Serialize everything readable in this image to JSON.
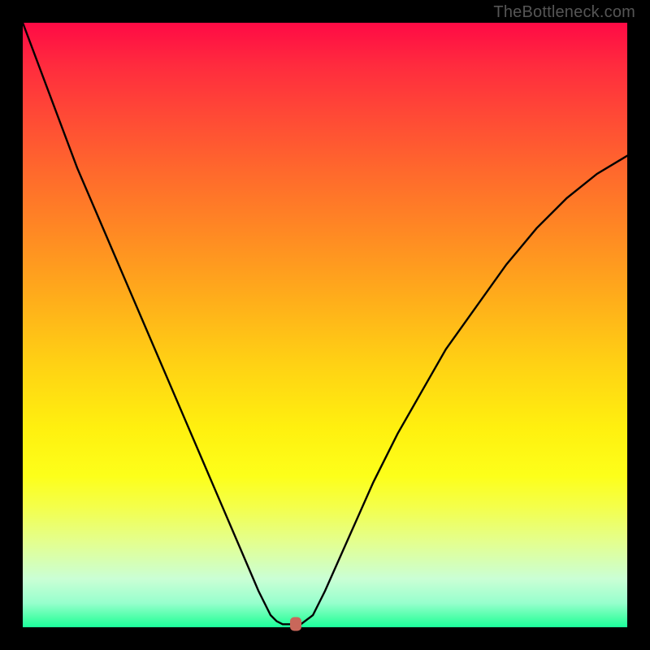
{
  "watermark": "TheBottleneck.com",
  "chart_data": {
    "type": "line",
    "title": "",
    "xlabel": "",
    "ylabel": "",
    "xlim": [
      0,
      100
    ],
    "ylim": [
      0,
      100
    ],
    "background_gradient": {
      "direction": "vertical",
      "stops": [
        {
          "pos": 0,
          "color": "#ff0a45"
        },
        {
          "pos": 25,
          "color": "#ff6a2c"
        },
        {
          "pos": 50,
          "color": "#ffc516"
        },
        {
          "pos": 75,
          "color": "#fdff1a"
        },
        {
          "pos": 100,
          "color": "#1bff9c"
        }
      ]
    },
    "series": [
      {
        "name": "curve",
        "color": "#000000",
        "x": [
          0,
          3,
          6,
          9,
          12,
          15,
          18,
          21,
          24,
          27,
          30,
          33,
          36,
          39,
          41,
          42,
          43,
          44,
          45,
          46,
          48,
          50,
          54,
          58,
          62,
          66,
          70,
          75,
          80,
          85,
          90,
          95,
          100
        ],
        "y": [
          100,
          92,
          84,
          76,
          69,
          62,
          55,
          48,
          41,
          34,
          27,
          20,
          13,
          6,
          2,
          1,
          0.5,
          0.5,
          0.5,
          0.5,
          2,
          6,
          15,
          24,
          32,
          39,
          46,
          53,
          60,
          66,
          71,
          75,
          78
        ]
      }
    ],
    "marker": {
      "x": 45.2,
      "y": 0.6,
      "color": "#c9675a"
    },
    "annotations": []
  }
}
